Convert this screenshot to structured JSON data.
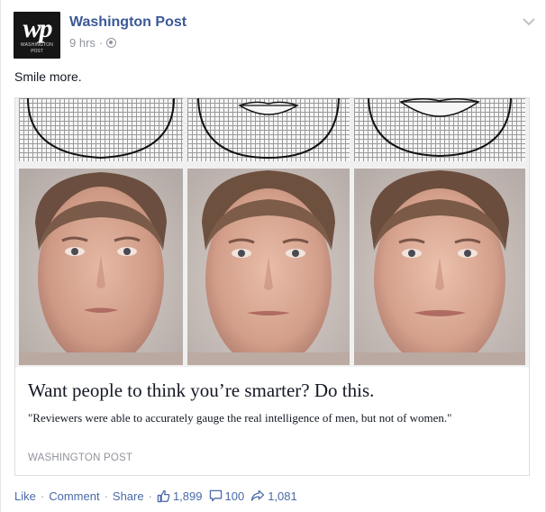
{
  "post": {
    "avatar": {
      "logo_text": "wp",
      "logo_sub_1": "WASHINGTON",
      "logo_sub_2": "POST"
    },
    "page_name": "Washington Post",
    "time": "9 hrs",
    "meta_separator": "·",
    "audience_icon": "globe-icon",
    "options_icon": "chevron-down-icon",
    "status_text": "Smile more.",
    "link": {
      "image_description_icon": "face-comparison-image",
      "title": "Want people to think you’re smarter? Do this.",
      "description": "\"Reviewers were able to accurately gauge the real intelligence of men, but not of women.\"",
      "source": "WASHINGTON POST"
    },
    "actions": {
      "like": "Like",
      "comment": "Comment",
      "share": "Share",
      "separator": "·"
    },
    "counts": {
      "likes": "1,899",
      "comments": "100",
      "shares": "1,081"
    },
    "colors": {
      "link_blue": "#3b5998",
      "footer_blue": "#4b6aa8",
      "meta_gray": "#90949c"
    }
  }
}
